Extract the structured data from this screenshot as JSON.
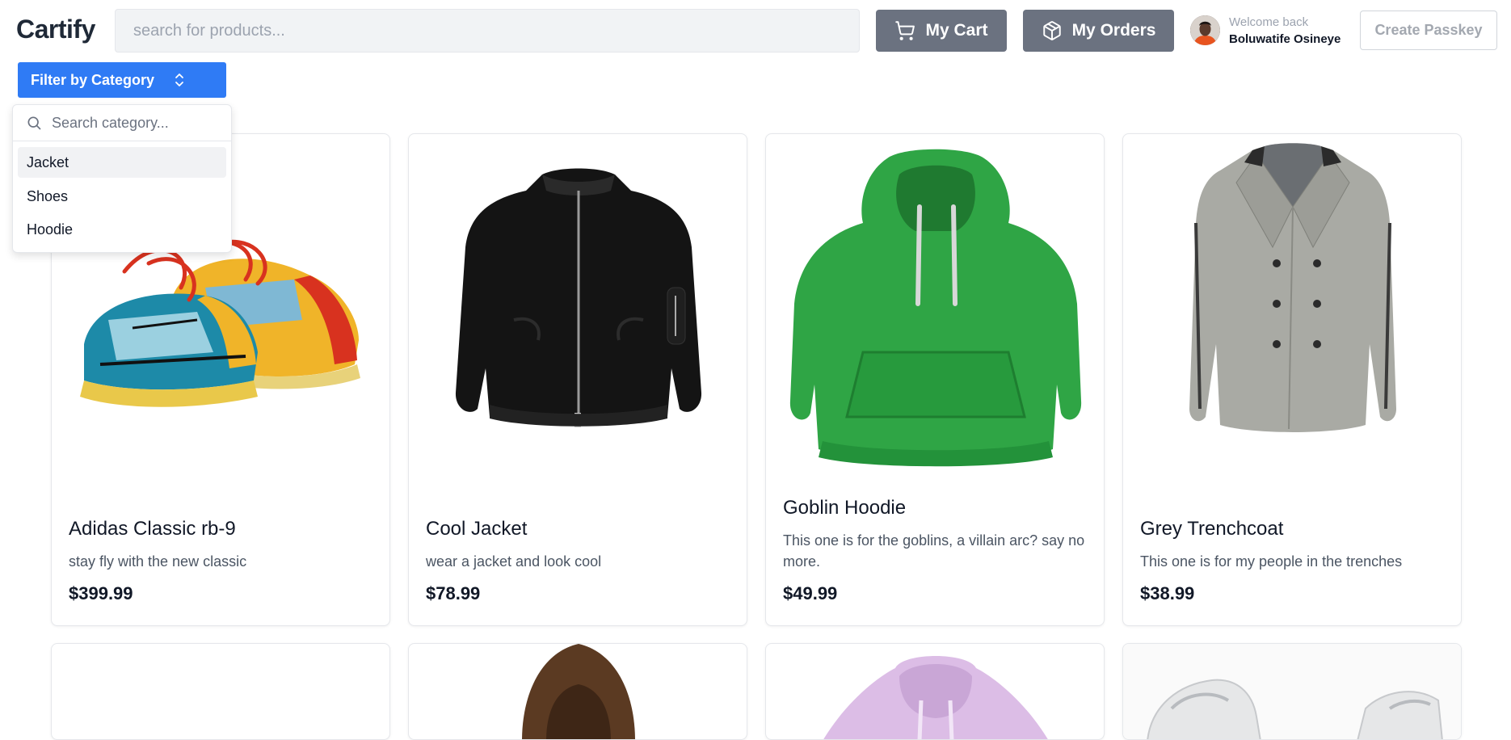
{
  "header": {
    "logo": "Cartify",
    "search_placeholder": "search for products...",
    "cart_label": "My Cart",
    "orders_label": "My Orders",
    "welcome_text": "Welcome back",
    "user_name": "Boluwatife Osineye",
    "passkey_label": "Create Passkey"
  },
  "filter": {
    "label": "Filter by Category",
    "search_placeholder": "Search category...",
    "options": [
      "Jacket",
      "Shoes",
      "Hoodie"
    ],
    "highlighted": "Jacket"
  },
  "products": [
    {
      "name": "Adidas Classic rb-9",
      "description": "stay fly with the new classic",
      "price": "$399.99"
    },
    {
      "name": "Cool Jacket",
      "description": "wear a jacket and look cool",
      "price": "$78.99"
    },
    {
      "name": "Goblin Hoodie",
      "description": "This one is for the goblins, a villain arc? say no more.",
      "price": "$49.99"
    },
    {
      "name": "Grey Trenchcoat",
      "description": "This one is for my people in the trenches",
      "price": "$38.99"
    }
  ],
  "colors": {
    "accent": "#2f7bf5",
    "button_gray": "#6b7280"
  }
}
